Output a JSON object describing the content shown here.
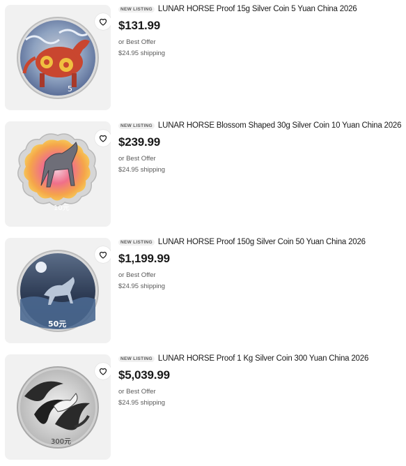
{
  "listings": [
    {
      "badge": "NEW LISTING",
      "title": "LUNAR HORSE Proof 15g Silver Coin 5 Yuan China 2026",
      "price": "$131.99",
      "offer": "or Best Offer",
      "shipping": "$24.95 shipping",
      "image_icon": "coin-image",
      "coin_denomination": "5",
      "watch_icon": "heart-icon"
    },
    {
      "badge": "NEW LISTING",
      "title": "LUNAR HORSE Blossom Shaped 30g Silver Coin 10 Yuan China 2026",
      "price": "$239.99",
      "offer": "or Best Offer",
      "shipping": "$24.95 shipping",
      "image_icon": "coin-image",
      "coin_denomination": "10元",
      "watch_icon": "heart-icon"
    },
    {
      "badge": "NEW LISTING",
      "title": "LUNAR HORSE Proof 150g Silver Coin 50 Yuan China 2026",
      "price": "$1,199.99",
      "offer": "or Best Offer",
      "shipping": "$24.95 shipping",
      "image_icon": "coin-image",
      "coin_denomination": "50元",
      "watch_icon": "heart-icon"
    },
    {
      "badge": "NEW LISTING",
      "title": "LUNAR HORSE Proof 1 Kg Silver Coin 300 Yuan China 2026",
      "price": "$5,039.99",
      "offer": "or Best Offer",
      "shipping": "$24.95 shipping",
      "image_icon": "coin-image",
      "coin_denomination": "300元",
      "watch_icon": "heart-icon"
    }
  ],
  "colors": {
    "thumb_bg": "#f1f1f1",
    "text": "#191919",
    "muted": "#5a5a5a"
  }
}
